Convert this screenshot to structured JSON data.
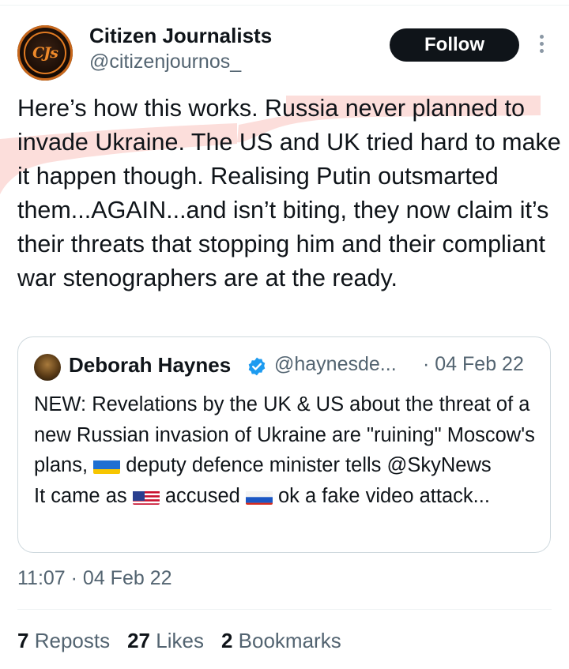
{
  "author": {
    "display_name": "Citizen Journalists",
    "handle": "@citizenjournos_",
    "avatar_text": "CJs"
  },
  "follow_label": "Follow",
  "tweet": {
    "text_before_highlight": "Here’s how this works. ",
    "text_highlighted": "Russia never planned to invade Ukraine. The US and UK tried hard to make it happen though.",
    "text_after_highlight": " Realising Putin outsmarted them...AGAIN...and isn’t biting, they now claim it’s their threats that stopping him and their compliant war stenographers are at the ready.",
    "highlight_color": "#f8c9c6"
  },
  "quote": {
    "name": "Deborah Haynes",
    "handle": "@haynesde...",
    "date": "· 04 Feb 22",
    "line1": "NEW: Revelations by the UK & US about the threat of a new Russian invasion of Ukraine are \"ruining\" Moscow's plans,",
    "line1b": "deputy defence minister tells @SkyNews",
    "line2a": "It came as",
    "line2b": "accused",
    "line2c": "ok a fake video attack...",
    "verified_color": "#1d9bf0"
  },
  "timestamp": "11:07 · 04 Feb 22",
  "stats": {
    "reposts_count": "7",
    "reposts_label": "Reposts",
    "likes_count": "27",
    "likes_label": "Likes",
    "bookmarks_count": "2",
    "bookmarks_label": "Bookmarks"
  },
  "colors": {
    "text": "#0f1419",
    "secondary": "#536471",
    "follow_bg": "#0f1419",
    "border": "#cfd9de"
  }
}
